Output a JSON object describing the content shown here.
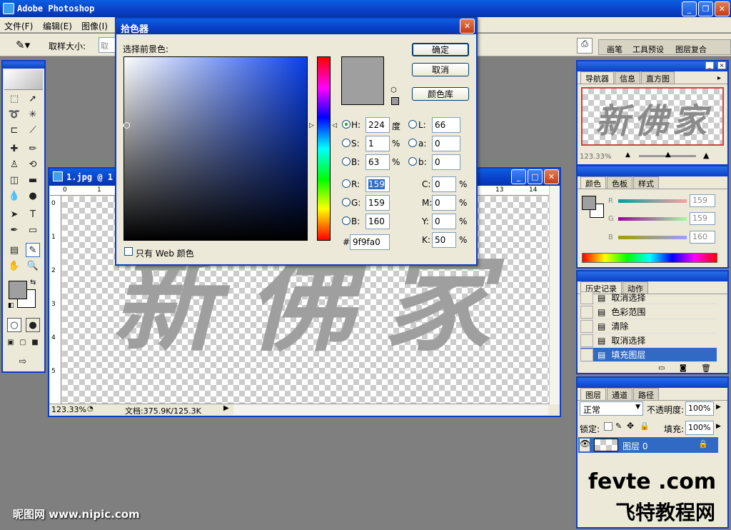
{
  "app": {
    "title": "Adobe Photoshop"
  },
  "menu": [
    "文件(F)",
    "编辑(E)",
    "图像(I)"
  ],
  "options": {
    "sample_label": "取样大小:",
    "sample_value": "取"
  },
  "palette_well": [
    "画笔",
    "工具预设",
    "图层复合"
  ],
  "document": {
    "title": "1.jpg @ 1",
    "zoom": "123.33%",
    "doc_info": "文档:375.9K/125.3K",
    "ruler_h": [
      "0",
      "1",
      "13",
      "14"
    ],
    "ruler_v": [
      "0",
      "1",
      "2",
      "3",
      "4",
      "5"
    ],
    "art_text": "新佛家"
  },
  "picker": {
    "title": "拾色器",
    "prompt": "选择前景色:",
    "ok": "确定",
    "cancel": "取消",
    "library": "颜色库",
    "web_only": "只有 Web 颜色",
    "hsb": {
      "H": "224",
      "H_unit": "度",
      "S": "1",
      "S_unit": "%",
      "B": "63",
      "B_unit": "%"
    },
    "lab": {
      "L": "66",
      "a": "0",
      "b": "0"
    },
    "rgb": {
      "R": "159",
      "G": "159",
      "B": "160"
    },
    "cmyk": {
      "C": "0",
      "M": "0",
      "Y": "0",
      "K": "50",
      "unit": "%"
    },
    "hex": "9f9fa0",
    "hex_prefix": "#",
    "labels": {
      "H": "H:",
      "S": "S:",
      "B": "B:",
      "L": "L:",
      "a": "a:",
      "b": "b:",
      "R": "R:",
      "G": "G:",
      "Bl": "B:",
      "C": "C:",
      "M": "M:",
      "Y": "Y:",
      "K": "K:"
    },
    "color_current": "#9f9fa0"
  },
  "navigator": {
    "tabs": [
      "导航器",
      "信息",
      "直方图"
    ],
    "zoom": "123.33%",
    "thumb_text": "新佛家"
  },
  "color_panel": {
    "tabs": [
      "颜色",
      "色板",
      "样式"
    ],
    "R": "159",
    "G": "159",
    "B": "160",
    "labels": [
      "R",
      "G",
      "B"
    ]
  },
  "history": {
    "tabs": [
      "历史记录",
      "动作"
    ],
    "items": [
      "取消选择",
      "色彩范围",
      "清除",
      "取消选择",
      "填充图层"
    ]
  },
  "layers": {
    "tabs": [
      "图层",
      "通道",
      "路径"
    ],
    "blend": "正常",
    "opacity_label": "不透明度:",
    "opacity": "100%",
    "lock_label": "锁定:",
    "fill_label": "填充:",
    "fill": "100%",
    "layer_name": "图层 0"
  },
  "watermarks": {
    "left": "昵图网 www.nipic.com",
    "right_top": "fevte .com",
    "right_bottom": "飞特教程网"
  },
  "colors": {
    "xp_blue": "#0a3fc8",
    "selection": "#316ac5",
    "fg": "#9f9fa0"
  }
}
